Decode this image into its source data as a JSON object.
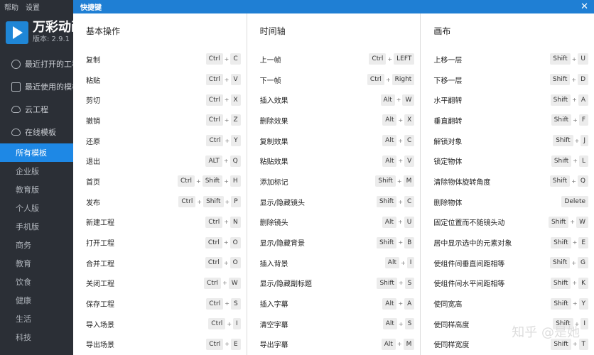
{
  "app": {
    "topbar": [
      "帮助",
      "设置"
    ],
    "brand_name": "万彩动画",
    "version": "版本: 2.9.1",
    "menu": [
      {
        "label": "最近打开的工程",
        "icon": "clock-icon"
      },
      {
        "label": "最近使用的模板",
        "icon": "template-icon"
      },
      {
        "label": "云工程",
        "icon": "cloud-icon"
      },
      {
        "label": "在线模板",
        "icon": "cloud-template-icon"
      }
    ],
    "categories": [
      "所有模板",
      "企业版",
      "教育版",
      "个人版",
      "手机版",
      "商务",
      "教育",
      "饮食",
      "健康",
      "生活",
      "科技"
    ],
    "active_category": "所有模板"
  },
  "dialog": {
    "title": "快捷键",
    "close": "✕",
    "watermark": "知乎 @是她",
    "columns": [
      {
        "heading": "基本操作",
        "rows": [
          {
            "label": "复制",
            "keys": [
              "Ctrl",
              "C"
            ]
          },
          {
            "label": "粘贴",
            "keys": [
              "Ctrl",
              "V"
            ]
          },
          {
            "label": "剪切",
            "keys": [
              "Ctrl",
              "X"
            ]
          },
          {
            "label": "撤销",
            "keys": [
              "Ctrl",
              "Z"
            ]
          },
          {
            "label": "还原",
            "keys": [
              "Ctrl",
              "Y"
            ]
          },
          {
            "label": "退出",
            "keys": [
              "ALT",
              "Q"
            ]
          },
          {
            "label": "首页",
            "keys": [
              "Ctrl",
              "Shift",
              "H"
            ]
          },
          {
            "label": "发布",
            "keys": [
              "Ctrl",
              "Shift",
              "P"
            ]
          },
          {
            "label": "新建工程",
            "keys": [
              "Ctrl",
              "N"
            ]
          },
          {
            "label": "打开工程",
            "keys": [
              "Ctrl",
              "O"
            ]
          },
          {
            "label": "合并工程",
            "keys": [
              "Ctrl",
              "O"
            ]
          },
          {
            "label": "关闭工程",
            "keys": [
              "Ctrl",
              "W"
            ]
          },
          {
            "label": "保存工程",
            "keys": [
              "Ctrl",
              "S"
            ]
          },
          {
            "label": "导入场景",
            "keys": [
              "Ctrl",
              "I"
            ]
          },
          {
            "label": "导出场景",
            "keys": [
              "Ctrl",
              "E"
            ]
          }
        ]
      },
      {
        "heading": "时间轴",
        "rows": [
          {
            "label": "上一帧",
            "keys": [
              "Ctrl",
              "LEFT"
            ]
          },
          {
            "label": "下一帧",
            "keys": [
              "Ctrl",
              "Right"
            ]
          },
          {
            "label": "插入效果",
            "keys": [
              "Alt",
              "W"
            ]
          },
          {
            "label": "删除效果",
            "keys": [
              "Alt",
              "X"
            ]
          },
          {
            "label": "复制效果",
            "keys": [
              "Alt",
              "C"
            ]
          },
          {
            "label": "粘贴效果",
            "keys": [
              "Alt",
              "V"
            ]
          },
          {
            "label": "添加标记",
            "keys": [
              "Shift",
              "M"
            ]
          },
          {
            "label": "显示/隐藏镜头",
            "keys": [
              "Shift",
              "C"
            ]
          },
          {
            "label": "删除镜头",
            "keys": [
              "Alt",
              "U"
            ]
          },
          {
            "label": "显示/隐藏背景",
            "keys": [
              "Shift",
              "B"
            ]
          },
          {
            "label": "插入背景",
            "keys": [
              "Alt",
              "I"
            ]
          },
          {
            "label": "显示/隐藏副标题",
            "keys": [
              "Shift",
              "S"
            ]
          },
          {
            "label": "插入字幕",
            "keys": [
              "Alt",
              "A"
            ]
          },
          {
            "label": "清空字幕",
            "keys": [
              "Alt",
              "S"
            ]
          },
          {
            "label": "导出字幕",
            "keys": [
              "Alt",
              "M"
            ]
          }
        ]
      },
      {
        "heading": "画布",
        "rows": [
          {
            "label": "上移一层",
            "keys": [
              "Shift",
              "U"
            ]
          },
          {
            "label": "下移一层",
            "keys": [
              "Shift",
              "D"
            ]
          },
          {
            "label": "水平翻转",
            "keys": [
              "Shift",
              "A"
            ]
          },
          {
            "label": "垂直翻转",
            "keys": [
              "Shift",
              "F"
            ]
          },
          {
            "label": "解锁对象",
            "keys": [
              "Shift",
              "J"
            ]
          },
          {
            "label": "锁定物体",
            "keys": [
              "Shift",
              "L"
            ]
          },
          {
            "label": "清除物体旋转角度",
            "keys": [
              "Shift",
              "Q"
            ]
          },
          {
            "label": "删除物体",
            "keys": [
              "Delete"
            ]
          },
          {
            "label": "固定位置而不随镜头动",
            "keys": [
              "Shift",
              "W"
            ]
          },
          {
            "label": "居中显示选中的元素对象",
            "keys": [
              "Shift",
              "E"
            ]
          },
          {
            "label": "使组件间垂直间距相等",
            "keys": [
              "Shift",
              "G"
            ]
          },
          {
            "label": "使组件间水平间距相等",
            "keys": [
              "Shift",
              "K"
            ]
          },
          {
            "label": "使同宽高",
            "keys": [
              "Shift",
              "Y"
            ]
          },
          {
            "label": "使同样高度",
            "keys": [
              "Shift",
              "I"
            ]
          },
          {
            "label": "使同样宽度",
            "keys": [
              "Shift",
              "T"
            ]
          }
        ]
      }
    ]
  }
}
